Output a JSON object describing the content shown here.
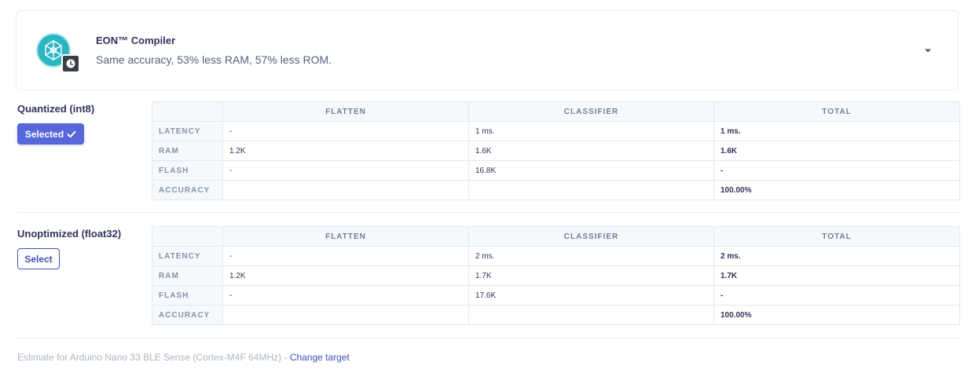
{
  "eon": {
    "icon": "eon-logo-icon",
    "badge_icon": "clock-icon",
    "title": "EON™ Compiler",
    "subtitle": "Same accuracy, 53% less RAM, 57% less ROM.",
    "toggle_icon": "caret-down-icon"
  },
  "columns": [
    "FLATTEN",
    "CLASSIFIER",
    "TOTAL"
  ],
  "variants": [
    {
      "label": "Quantized (int8)",
      "button_label": "Selected",
      "button_icon": "check-icon",
      "selected": true,
      "rows": [
        {
          "name": "LATENCY",
          "flatten": "-",
          "classifier": "1 ms.",
          "total": "1 ms."
        },
        {
          "name": "RAM",
          "flatten": "1.2K",
          "classifier": "1.6K",
          "total": "1.6K"
        },
        {
          "name": "FLASH",
          "flatten": "-",
          "classifier": "16.8K",
          "total": "-"
        },
        {
          "name": "ACCURACY",
          "flatten": "",
          "classifier": "",
          "total": "100.00%"
        }
      ]
    },
    {
      "label": "Unoptimized (float32)",
      "button_label": "Select",
      "selected": false,
      "rows": [
        {
          "name": "LATENCY",
          "flatten": "-",
          "classifier": "2 ms.",
          "total": "2 ms."
        },
        {
          "name": "RAM",
          "flatten": "1.2K",
          "classifier": "1.7K",
          "total": "1.7K"
        },
        {
          "name": "FLASH",
          "flatten": "-",
          "classifier": "17.6K",
          "total": "-"
        },
        {
          "name": "ACCURACY",
          "flatten": "",
          "classifier": "",
          "total": "100.00%"
        }
      ]
    }
  ],
  "footer": {
    "text": "Estimate for Arduino Nano 33 BLE Sense (Cortex-M4F 64MHz) - ",
    "link": "Change target"
  },
  "colors": {
    "accent": "#5567d9",
    "link": "#3f51b5",
    "logo": "#2bb6c1"
  }
}
